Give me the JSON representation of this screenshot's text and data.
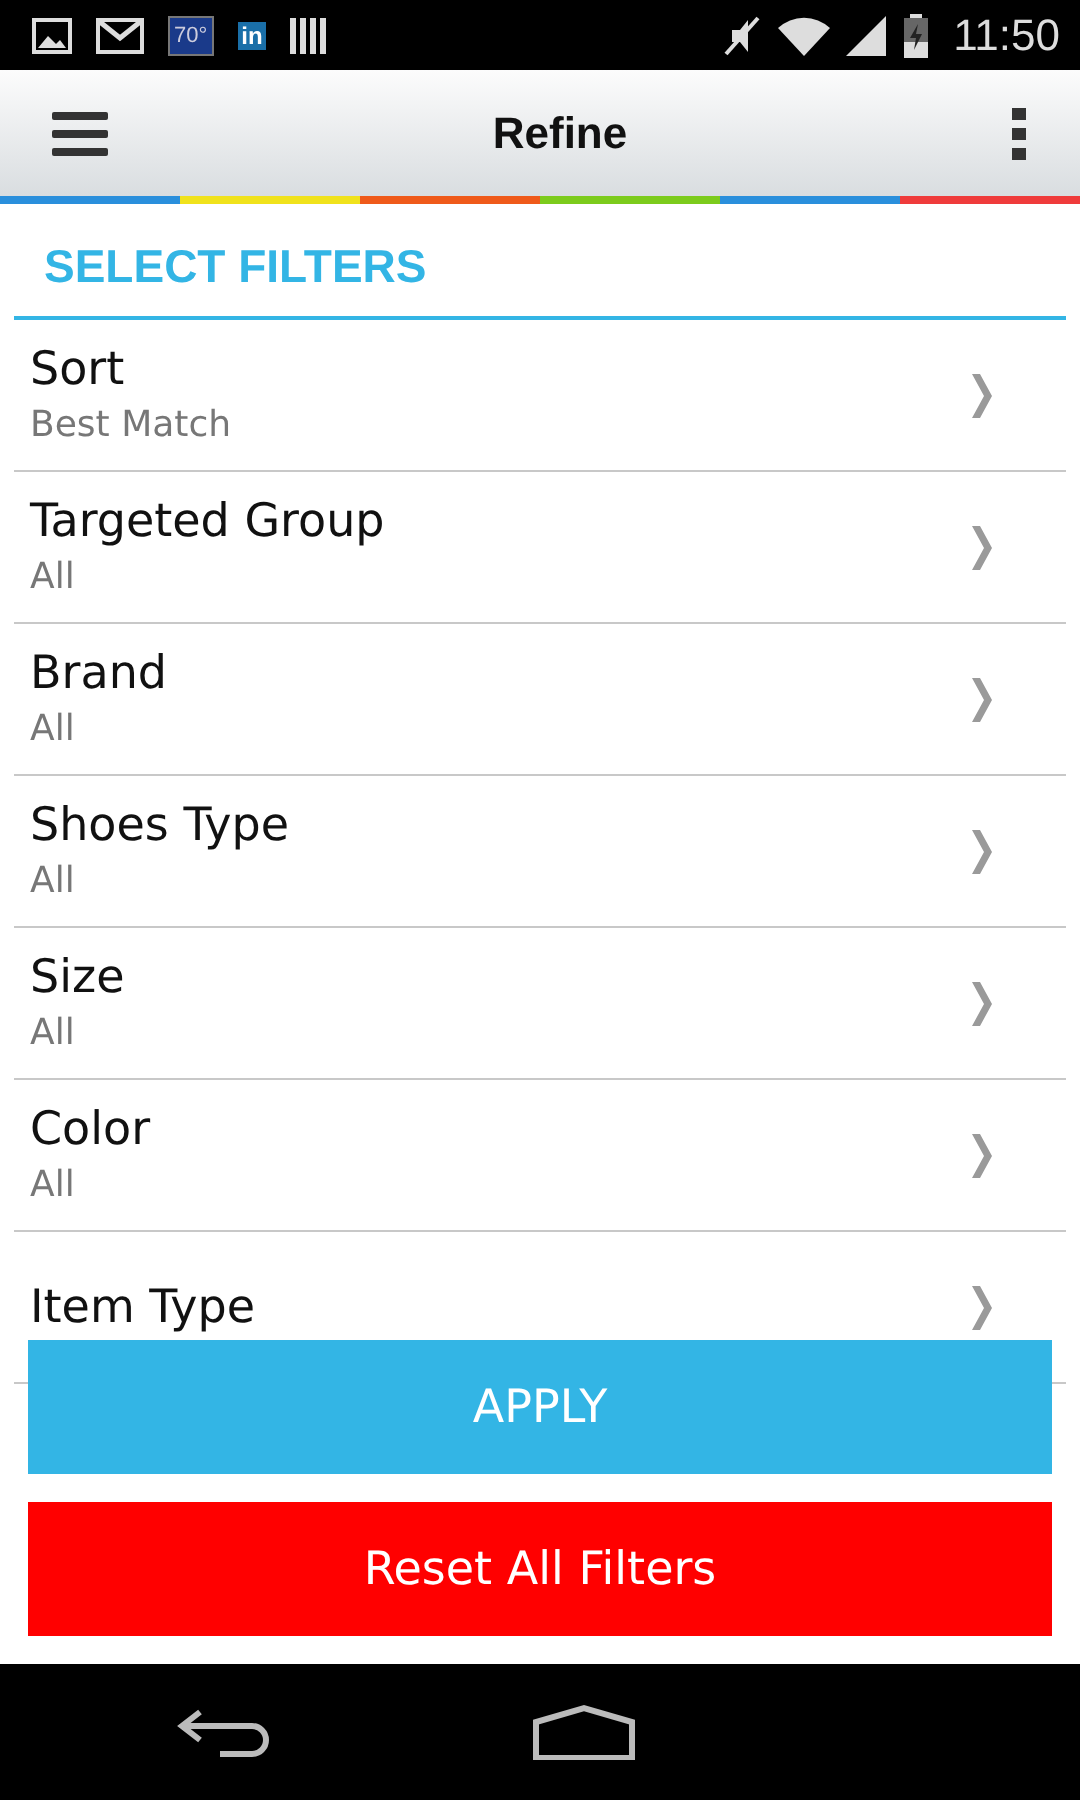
{
  "status_bar": {
    "weather": "70°",
    "linkedin": "in",
    "time": "11:50"
  },
  "header": {
    "title": "Refine"
  },
  "section_title": "SELECT FILTERS",
  "filters": [
    {
      "label": "Sort",
      "value": "Best Match"
    },
    {
      "label": "Targeted Group",
      "value": "All"
    },
    {
      "label": "Brand",
      "value": "All"
    },
    {
      "label": "Shoes Type",
      "value": "All"
    },
    {
      "label": "Size",
      "value": "All"
    },
    {
      "label": "Color",
      "value": "All"
    },
    {
      "label": "Item Type"
    }
  ],
  "buttons": {
    "apply": "APPLY",
    "reset": "Reset All Filters"
  }
}
